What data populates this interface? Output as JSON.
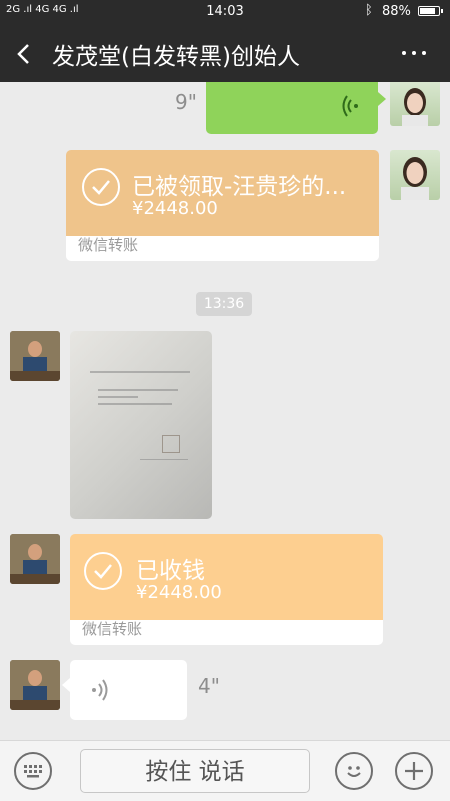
{
  "status": {
    "signal": "2G .ıl 4G 4G .ıl",
    "time": "14:03",
    "bluetooth_icon": "bluetooth-icon",
    "battery_text": "88%",
    "battery_level": 0.88
  },
  "header": {
    "title": "发茂堂(白发转黑)创始人",
    "back_icon": "back-arrow-icon",
    "more_icon": "more-dots-icon"
  },
  "messages": {
    "voice_out": {
      "duration": "9\"",
      "icon": "voice-wave-icon"
    },
    "transfer_out": {
      "title": "已被领取-汪贵珍的...",
      "amount": "¥2448.00",
      "label": "微信转账",
      "color": "#efc48b"
    },
    "timestamp": "13:36",
    "image": {
      "icon": "photo-document-icon"
    },
    "transfer_in": {
      "title": "已收钱",
      "amount": "¥2448.00",
      "label": "微信转账",
      "color": "#fdcf90"
    },
    "voice_in": {
      "duration": "4\"",
      "icon": "voice-wave-icon"
    }
  },
  "input_bar": {
    "talk_label": "按住 说话",
    "keyboard_icon": "keyboard-icon",
    "emoji_icon": "emoji-icon",
    "plus_icon": "plus-icon"
  },
  "colors": {
    "header_bg": "#2b2b2b",
    "chat_bg": "#ebebeb",
    "voice_out_bg": "#8fd35a"
  }
}
